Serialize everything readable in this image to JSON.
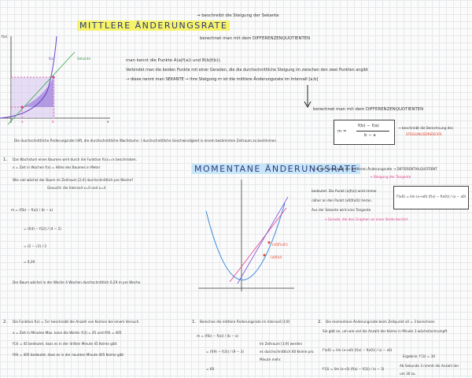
{
  "section1": {
    "title": "MITTLERE ÄNDERUNGSRATE",
    "note1": "→ beschreibt die Steigung der Sekante",
    "note2": "berechnet man mit dem DIFFERENZENQUOTIENTEN",
    "line1": "man kennt die Punkte A(a|f(a)) und B(b|f(b)).",
    "line2": "Verbindet man die beiden Punkte mit einer Geraden, die die durchschnittliche Steigung im zwischen den zwei Punkten angibt",
    "line3": "→ diese nennt man SEKANTE → ihre Steigung m ist die mittlere Änderungsrate im Intervall [a;b]",
    "line4": "berechnet man mit dem DIFFERENZENQUOTIENTEN",
    "formula_lhs": "m =",
    "formula_num": "f(b) − f(a)",
    "formula_den": "b − a",
    "formula_note1": "→ beschreibt die Berechnung des",
    "formula_note2": "STEIGUNGSDREIECKS",
    "summary": "Die durchschnittliche Änderungsrate hilft, die durchschnittliche Wachstums- / durchschnittliche Geschwindigkeit in einem bestimmten Zeitraum zu bestimmen",
    "graph": {
      "y_label": "f(x)",
      "x_label": "x",
      "curve_label": "f(x)",
      "secant_label": "Sekante",
      "a_label": "a",
      "b_label": "b"
    }
  },
  "example1": {
    "num": "1.",
    "l1": "Das Wachstum eines Baumes wird durch die Funktion f(x)=√x beschrieben.",
    "l2": "x = Zeit in Wochen    f(x) = Höhe des Baumes in Meter",
    "l3": "Wie viel wächst der Baum im Zeitraum [2;4] durchschnittlich pro Woche?",
    "l4": "Gesucht: die Intervall x=0 und x=4",
    "m1": "m = (f(b) − f(a)) / (b − a)",
    "m2": "= (f(4) − f(2)) / (4 − 2)",
    "m3": "= (2 − √2) / 2",
    "m4": "= 0,29",
    "answer": "Der Baum wächst in der Woche 4 Wochen durchschnittlich 0,29 m pro Woche."
  },
  "section2": {
    "title": "MOMENTANE ÄNDERUNGSRATE",
    "n1": "→ ist der Grenzwert der mittleren Änderungsrate → DIFFERENTIALQUOTIENT",
    "n2": "→ Steigung der Tangente",
    "b1": "bedeutet: Die Punkt (a|f(a)) wird immer",
    "b2": "näher an den Punkt (x0|f(x0)) heran.",
    "b3": "Aus der Sekante wird eine Tangente",
    "b4": "→ Gerade, die den Graphen an einer Stelle berührt",
    "limit": "f'(x0) = lim (x→x0) (f(x) − f(x0)) / (x − x0)",
    "point1": "(x0|f(x0))",
    "point2": "(a|f(a))"
  },
  "example2": {
    "num": "2.",
    "l1": "Die Funktion f(x) = 5x² beschreibt die Anzahl von Keimen bei einem Versuch.",
    "l2": "x = Zeit in Minuten    Max. kann die Werte: f(3) = 45 und f(9) = 405",
    "l3": "f(3) = 45 bedeutet, dass es in der dritten Minute 45 Keime gibt",
    "l4": "f(9) = 405 bedeutet, dass es in der neunten Minute 405 Keime gibt"
  },
  "example3": {
    "num": "1.",
    "l1": "Berechne die mittlere Änderungsrate im Intervall [3;9]",
    "m1": "m = (f(b) − f(a)) / (b − a)",
    "m2": "= (f(9) − f(3)) / (9 − 3)",
    "m3": "= 60",
    "r1": "Im Zeitraum [3;9] werden",
    "r2": "es durchschnittlich 60 Keime pro",
    "r3": "Minute mehr."
  },
  "example4": {
    "num": "2.",
    "l1": "Die momentane Änderungsrate beim Zeitpunkt x0 = 3 berechnen",
    "l2": "Sie gibt an, um wie viel die Anzahl der Keime in Minute 3 wächst/schrumpft",
    "f1": "f'(x0) = lim (x→x0) (f(x) − f(x0)) / (x − x0)",
    "f2": "f'(3) = lim (x→3) (f(x) − f(3)) / (x − 3)",
    "res": "Ergebnis: f'(3) = 30",
    "r1": "Ab Sekunde 3 nimmt die Anzahl der",
    "r2": "um 30 zu."
  }
}
